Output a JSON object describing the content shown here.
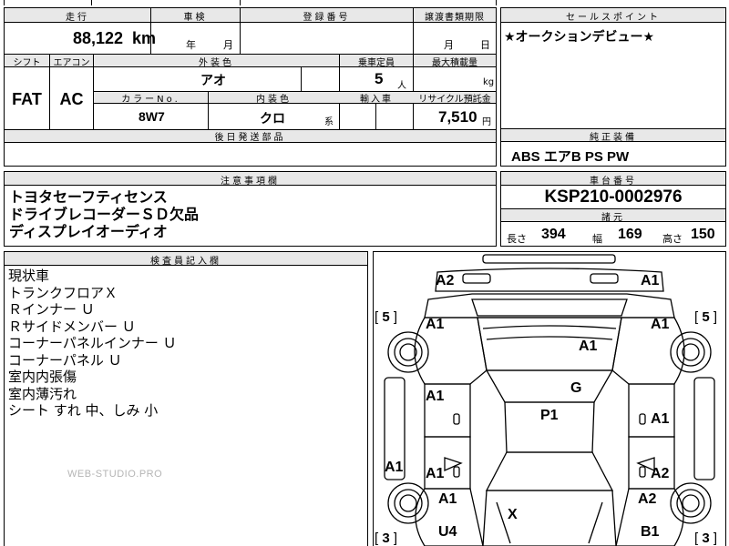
{
  "header": {
    "mileage_label": "走行",
    "inspection_label": "車検",
    "registration_label": "登録番号",
    "transfer_label": "譲渡書類期限",
    "sales_point_label": "セールスポイント",
    "mileage_value": "88,122",
    "mileage_unit": "km",
    "inspection_year": "年",
    "inspection_month": "月",
    "transfer_month": "月",
    "transfer_day": "日",
    "sales_point_text": "★オークションデビュー★"
  },
  "specs": {
    "shift_label": "シフト",
    "ac_label": "エアコン",
    "exterior_color_label": "外装色",
    "capacity_label": "乗車定員",
    "max_load_label": "最大積載量",
    "shift_value": "FAT",
    "ac_value": "AC",
    "exterior_color_value": "アオ",
    "capacity_value": "5",
    "capacity_unit": "人",
    "max_load_unit": "kg",
    "color_no_label": "カラーNo.",
    "interior_color_label": "内装色",
    "import_label": "輸入車",
    "recycle_label": "リサイクル預託金",
    "color_no_value": "8W7",
    "interior_color_value": "クロ",
    "interior_suffix": "系",
    "recycle_value": "7,510",
    "recycle_unit": "円",
    "later_parts_label": "後日発送部品"
  },
  "equipment": {
    "label": "純正装備",
    "value": "ABS エアB PS PW"
  },
  "notes": {
    "label": "注意事項欄",
    "lines": [
      "トヨタセーフティセンス",
      "ドライブレコーダーＳＤ欠品",
      "ディスプレイオーディオ"
    ]
  },
  "chassis": {
    "label": "車台番号",
    "value": "KSP210-0002976",
    "dims_label": "諸元",
    "length_label": "長さ",
    "length_value": "394",
    "width_label": "幅",
    "width_value": "169",
    "height_label": "高さ",
    "height_value": "150"
  },
  "inspector": {
    "label": "検査員記入欄",
    "lines": [
      "現状車",
      "トランクフロアＸ",
      "Ｒインナー Ｕ",
      "Ｒサイドメンバー Ｕ",
      "コーナーパネルインナー Ｕ",
      "コーナーパネル Ｕ",
      "室内内張傷",
      "室内薄汚れ",
      "シート すれ 中、しみ 小"
    ],
    "watermark": "WEB-STUDIO.PRO"
  },
  "diagram": {
    "marks": {
      "rear_left_corner": "A2",
      "rear_right_corner": "A1",
      "left_quarter": "A1",
      "trunk_lid": "A1",
      "right_quarter": "A1",
      "left_rear_door": "A1",
      "roof_rear": "G",
      "roof": "P1",
      "right_rear_door": "A1",
      "left_sill": "A1",
      "left_front_door": "A1",
      "right_front_door": "A2",
      "left_fender": "A1",
      "right_fender": "A2",
      "hood": "X",
      "left_front_corner": "U4",
      "right_front_corner": "B1"
    },
    "tires": {
      "rear_left": "5",
      "rear_right": "5",
      "front_left": "3",
      "front_right": "3"
    }
  }
}
